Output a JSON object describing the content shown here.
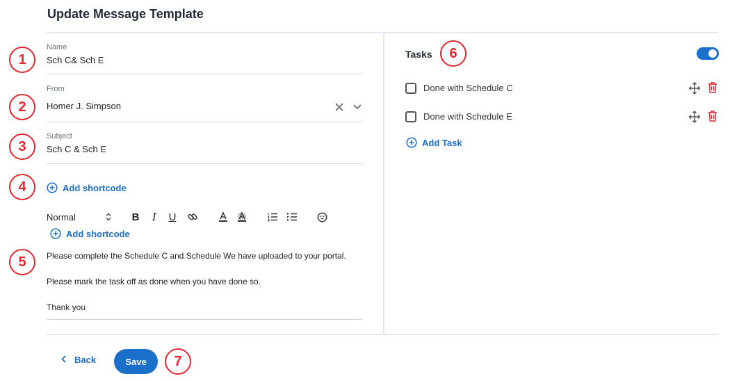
{
  "page": {
    "title": "Update Message Template"
  },
  "form": {
    "name": {
      "label": "Name",
      "value": "Sch C& Sch E"
    },
    "from": {
      "label": "From",
      "value": "Homer J. Simpson"
    },
    "subject": {
      "label": "Subject",
      "value": "Sch C & Sch E"
    },
    "add_shortcode_label": "Add shortcode"
  },
  "editor": {
    "toolbar": {
      "format_select": "Normal",
      "bold": "B",
      "italic": "I",
      "underline": "U"
    },
    "add_shortcode_label": "Add shortcode",
    "body": [
      "Please complete the Schedule C and Schedule We have uploaded to your portal.",
      "Please mark the task off as done when you have done so.",
      "Thank you"
    ]
  },
  "tasks": {
    "title": "Tasks",
    "toggle_on": true,
    "items": [
      {
        "label": "Done with Schedule C",
        "checked": false
      },
      {
        "label": "Done with Schedule E",
        "checked": false
      }
    ],
    "add_task_label": "Add Task"
  },
  "footer": {
    "back_label": "Back",
    "save_label": "Save"
  },
  "annotations": [
    "1",
    "2",
    "3",
    "4",
    "5",
    "6",
    "7"
  ],
  "colors": {
    "accent": "#1a6fc9",
    "delete": "#e0282e",
    "annotation": "#e0282e"
  }
}
